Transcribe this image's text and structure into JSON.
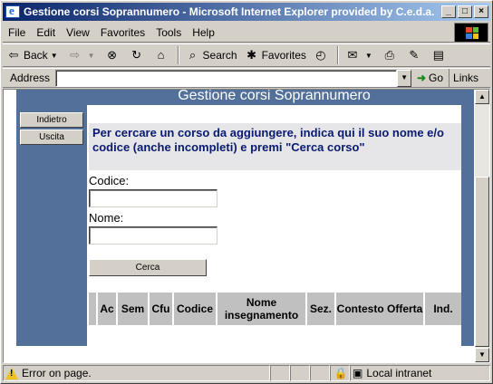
{
  "window": {
    "title": "Gestione corsi Soprannumero - Microsoft Internet Explorer provided by C.e.d.a."
  },
  "menu": [
    {
      "label": "File"
    },
    {
      "label": "Edit"
    },
    {
      "label": "View"
    },
    {
      "label": "Favorites"
    },
    {
      "label": "Tools"
    },
    {
      "label": "Help"
    }
  ],
  "toolbar": {
    "back": "Back",
    "search": "Search",
    "favorites": "Favorites"
  },
  "address": {
    "label": "Address",
    "value": "",
    "go": "Go",
    "links": "Links"
  },
  "page": {
    "title": "Gestione corsi Soprannumero",
    "side_buttons": {
      "back": "Indietro",
      "exit": "Uscita"
    },
    "notice": "Per cercare un corso da aggiungere, indica qui il suo nome e/o codice (anche incompleti) e premi \"Cerca corso\"",
    "codice_label": "Codice:",
    "codice_value": "",
    "nome_label": "Nome:",
    "nome_value": "",
    "search_button": "Cerca",
    "columns": [
      "Ac",
      "Sem",
      "Cfu",
      "Codice",
      "Nome insegnamento",
      "Sez.",
      "Contesto Offerta",
      "Ind."
    ]
  },
  "status": {
    "message": "Error on page.",
    "zone": "Local intranet"
  }
}
